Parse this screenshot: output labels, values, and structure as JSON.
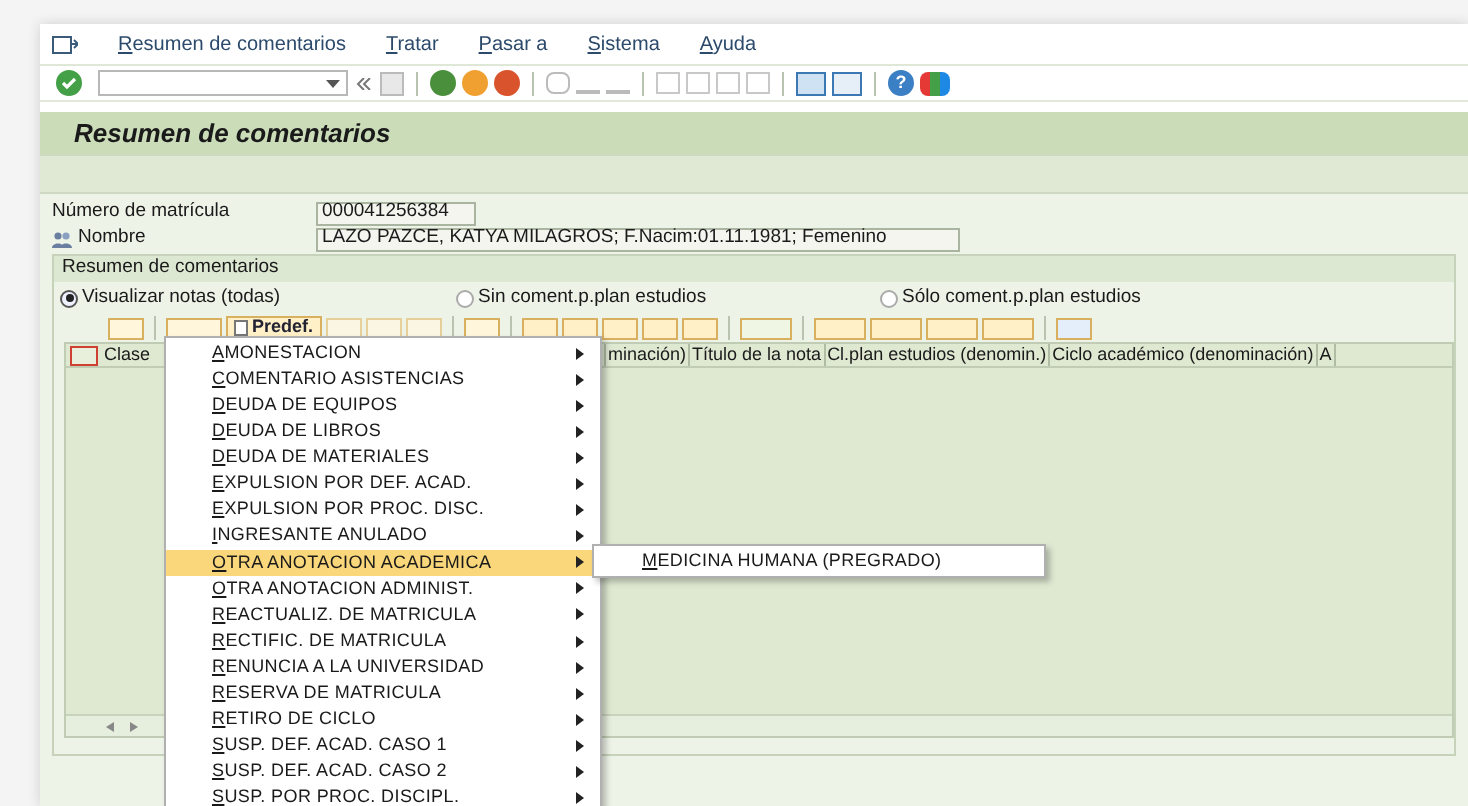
{
  "menu_bar": [
    {
      "label": "Resumen de comentarios"
    },
    {
      "label": "Tratar"
    },
    {
      "label": "Pasar a"
    },
    {
      "label": "Sistema"
    },
    {
      "label": "Ayuda"
    }
  ],
  "help_button": "?",
  "screen_title": "Resumen de comentarios",
  "fields": [
    {
      "label": "Número de matrícula",
      "value": "000041256384",
      "kind": "short"
    },
    {
      "label": "Nombre",
      "value": "LAZO PAZCE, KATYA MILAGROS; F.Nacim:01.11.1981; Femenino",
      "kind": "person"
    }
  ],
  "group_title": "Resumen de comentarios",
  "radios": [
    {
      "label": "Visualizar notas (todas)",
      "selected": true
    },
    {
      "label": "Sin coment.p.plan estudios",
      "selected": false
    },
    {
      "label": "Sólo coment.p.plan estudios",
      "selected": false
    }
  ],
  "predef_button": "Predef.",
  "table": {
    "columns": [
      "Clase",
      "minación)",
      "Título de la nota",
      "Cl.plan estudios (denomin.)",
      "Ciclo académico (denominación)",
      "A"
    ]
  },
  "context_menu": [
    {
      "label": "AMONESTACION",
      "selected": false
    },
    {
      "label": "COMENTARIO ASISTENCIAS",
      "selected": false
    },
    {
      "label": "DEUDA DE EQUIPOS",
      "selected": false
    },
    {
      "label": "DEUDA DE LIBROS",
      "selected": false
    },
    {
      "label": "DEUDA DE MATERIALES",
      "selected": false
    },
    {
      "label": "EXPULSION POR DEF. ACAD.",
      "selected": false
    },
    {
      "label": "EXPULSION POR PROC. DISC.",
      "selected": false
    },
    {
      "label": "INGRESANTE ANULADO",
      "selected": false
    },
    {
      "label": "OTRA ANOTACION ACADEMICA",
      "selected": true,
      "submenu": [
        "MEDICINA HUMANA (PREGRADO)"
      ]
    },
    {
      "label": "OTRA ANOTACION ADMINIST.",
      "selected": false
    },
    {
      "label": "REACTUALIZ. DE MATRICULA",
      "selected": false
    },
    {
      "label": "RECTIFIC. DE MATRICULA",
      "selected": false
    },
    {
      "label": "RENUNCIA A LA UNIVERSIDAD",
      "selected": false
    },
    {
      "label": "RESERVA DE MATRICULA",
      "selected": false
    },
    {
      "label": "RETIRO DE CICLO",
      "selected": false
    },
    {
      "label": "SUSP. DEF. ACAD. CASO 1",
      "selected": false
    },
    {
      "label": "SUSP. DEF. ACAD. CASO 2",
      "selected": false
    },
    {
      "label": "SUSP. POR PROC. DISCIPL.",
      "selected": false
    }
  ]
}
